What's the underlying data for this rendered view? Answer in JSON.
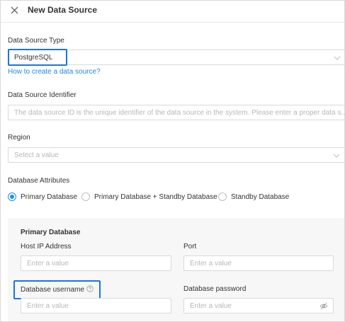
{
  "header": {
    "title": "New Data Source",
    "close_icon": "close-icon"
  },
  "data_source_type": {
    "label": "Data Source Type",
    "value": "PostgreSQL",
    "help_link": "How to create a data source?"
  },
  "identifier": {
    "label": "Data Source Identifier",
    "placeholder": "The data source ID is the unique identifier of the data source in the system. Please enter a proper data s..."
  },
  "region": {
    "label": "Region",
    "placeholder": "Select a value"
  },
  "attributes": {
    "label": "Database Attributes",
    "options": [
      "Primary Database",
      "Primary Database + Standby Database",
      "Standby Database"
    ],
    "selected": "Primary Database"
  },
  "primary_section": {
    "title": "Primary Database",
    "host_label": "Host IP Address",
    "host_placeholder": "Enter a value",
    "port_label": "Port",
    "port_placeholder": "Enter a value",
    "username_label": "Database username",
    "username_placeholder": "Enter a value",
    "password_label": "Database password",
    "password_placeholder": "Enter a value"
  },
  "colors": {
    "accent": "#1890ff",
    "highlight": "#1a73e8",
    "link": "#1e88e5"
  }
}
